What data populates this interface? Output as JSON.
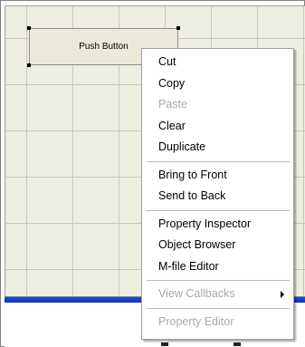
{
  "canvas": {
    "push_button_label": "Push Button"
  },
  "context_menu": {
    "items": [
      {
        "label": "Cut",
        "enabled": true
      },
      {
        "label": "Copy",
        "enabled": true
      },
      {
        "label": "Paste",
        "enabled": false
      },
      {
        "label": "Clear",
        "enabled": true
      },
      {
        "label": "Duplicate",
        "enabled": true
      },
      {
        "label": "Bring to Front",
        "enabled": true
      },
      {
        "label": "Send to Back",
        "enabled": true
      },
      {
        "label": "Property Inspector",
        "enabled": true
      },
      {
        "label": "Object Browser",
        "enabled": true
      },
      {
        "label": "M-file Editor",
        "enabled": true
      },
      {
        "label": "View Callbacks",
        "enabled": false
      },
      {
        "label": "Property Editor",
        "enabled": false
      }
    ]
  },
  "colors": {
    "canvas_bg": "#eeeee0",
    "grid_line": "#c8c8b8",
    "accent_bar": "#1b4fd6",
    "disabled_text": "#a8a8a8"
  },
  "icons": {
    "submenu_arrow": "chevron-right-icon",
    "selection_handle": "square-handle-icon"
  }
}
